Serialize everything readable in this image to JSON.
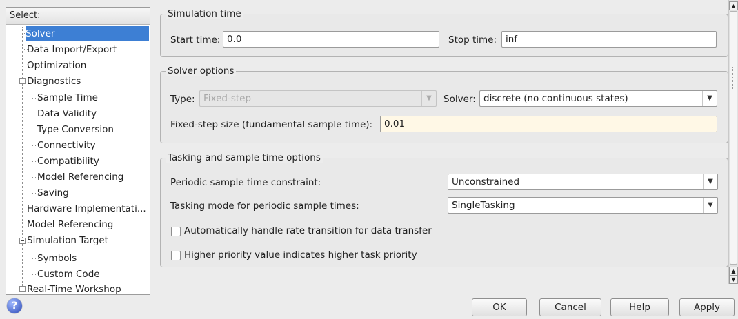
{
  "tree": {
    "header": "Select:",
    "items": [
      {
        "label": "Solver",
        "selected": true
      },
      {
        "label": "Data Import/Export"
      },
      {
        "label": "Optimization"
      },
      {
        "label": "Diagnostics"
      },
      {
        "label": "Sample Time"
      },
      {
        "label": "Data Validity"
      },
      {
        "label": "Type Conversion"
      },
      {
        "label": "Connectivity"
      },
      {
        "label": "Compatibility"
      },
      {
        "label": "Model Referencing"
      },
      {
        "label": "Saving"
      },
      {
        "label": "Hardware Implementati..."
      },
      {
        "label": "Model Referencing"
      },
      {
        "label": "Simulation Target"
      },
      {
        "label": "Symbols"
      },
      {
        "label": "Custom Code"
      },
      {
        "label": "Real-Time Workshop"
      }
    ]
  },
  "simulation_time": {
    "title": "Simulation time",
    "start_label": "Start time:",
    "start_value": "0.0",
    "stop_label": "Stop time:",
    "stop_value": "inf"
  },
  "solver_options": {
    "title": "Solver options",
    "type_label": "Type:",
    "type_value": "Fixed-step",
    "solver_label": "Solver:",
    "solver_value": "discrete (no continuous states)",
    "step_label": "Fixed-step size (fundamental sample time):",
    "step_value": "0.01"
  },
  "tasking": {
    "title": "Tasking and sample time options",
    "periodic_label": "Periodic sample time constraint:",
    "periodic_value": "Unconstrained",
    "mode_label": "Tasking mode for periodic sample times:",
    "mode_value": "SingleTasking",
    "auto_rate_label": "Automatically handle rate transition for data transfer",
    "auto_rate_checked": false,
    "priority_label": "Higher priority value indicates higher task priority",
    "priority_checked": false
  },
  "buttons": {
    "ok_label": "OK",
    "cancel_label": "Cancel",
    "help_label": "Help",
    "apply_label": "Apply"
  },
  "icons": {
    "help": "help-icon",
    "dropdown": "chevron-down-icon",
    "scroll_up": "arrow-up-icon",
    "scroll_down": "arrow-down-icon"
  },
  "colors": {
    "selection": "#3d7fd4",
    "highlight_field": "#fff8e6"
  }
}
